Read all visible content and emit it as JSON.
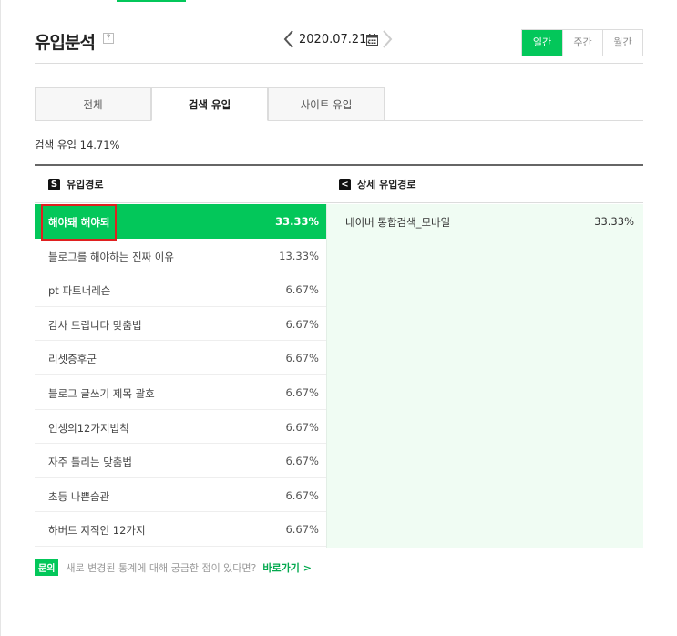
{
  "header": {
    "title": "유입분석",
    "help_icon": "?",
    "date": "2020.07.21.",
    "period_tabs": [
      "일간",
      "주간",
      "월간"
    ],
    "active_period": "일간"
  },
  "tabs": {
    "all": "전체",
    "search": "검색 유입",
    "site": "사이트 유입"
  },
  "summary": "검색 유입 14.71%",
  "columns": {
    "left_icon": "S",
    "left": "유입경로",
    "right_icon": "<",
    "right": "상세 유입경로"
  },
  "rows": [
    {
      "label": "해야돼 해야되",
      "pct": "33.33%"
    },
    {
      "label": "블로그를 해야하는 진짜 이유",
      "pct": "13.33%"
    },
    {
      "label": "pt 파트너레슨",
      "pct": "6.67%"
    },
    {
      "label": "감사 드립니다 맞춤법",
      "pct": "6.67%"
    },
    {
      "label": "리셋증후군",
      "pct": "6.67%"
    },
    {
      "label": "블로그 글쓰기 제목 괄호",
      "pct": "6.67%"
    },
    {
      "label": "인생의12가지법칙",
      "pct": "6.67%"
    },
    {
      "label": "자주 틀리는 맞춤법",
      "pct": "6.67%"
    },
    {
      "label": "초등 나쁜습관",
      "pct": "6.67%"
    },
    {
      "label": "하버드 지적인 12가지",
      "pct": "6.67%"
    }
  ],
  "detail": [
    {
      "label": "네이버 통합검색_모바일",
      "pct": "33.33%"
    }
  ],
  "footer": {
    "badge": "문의",
    "text": "새로 변경된 통계에 대해 궁금한 점이 있다면?",
    "link": "바로가기 >"
  },
  "colors": {
    "accent": "#03c75a",
    "highlight": "#e02020",
    "detail_bg": "#f0fcf3"
  }
}
